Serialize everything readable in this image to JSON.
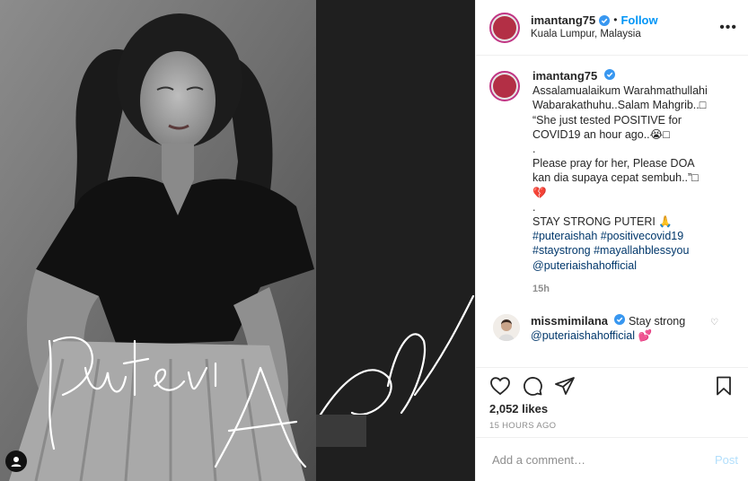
{
  "post": {
    "username": "imantang75",
    "follow_label": "Follow",
    "location": "Kuala Lumpur, Malaysia",
    "more_label": "•••",
    "photo_signature": "Puteri Aishah"
  },
  "caption": {
    "username": "imantang75",
    "lines": [
      "Assalamualaikum Warahmathullahi",
      "Wabarakathuhu..Salam Mahgrib..□",
      "“She just tested POSITIVE for",
      "COVID19 an hour ago..😭□",
      ".",
      "Please pray for her, Please DOA",
      "kan dia supaya cepat sembuh..”□",
      "💔",
      ".",
      "STAY STRONG PUTERI 🙏"
    ],
    "hashtags": [
      "#puteraishah #positivecovid19",
      "#staystrong #mayallahblessyou",
      "@puteriaishahofficial"
    ],
    "time": "15h"
  },
  "comment": {
    "username": "missmimilana",
    "text": "Stay strong",
    "mention": "@puteriaishahofficial",
    "emoji": "💕",
    "heart": "♡"
  },
  "actions": {
    "likes": "2,052 likes",
    "posted_ago": "15 HOURS AGO"
  },
  "add_comment": {
    "placeholder": "Add a comment…",
    "post_label": "Post"
  },
  "colors": {
    "follow": "#0095f6",
    "link": "#00376b",
    "muted": "#8e8e8e",
    "post_disabled": "#b2dffc"
  }
}
